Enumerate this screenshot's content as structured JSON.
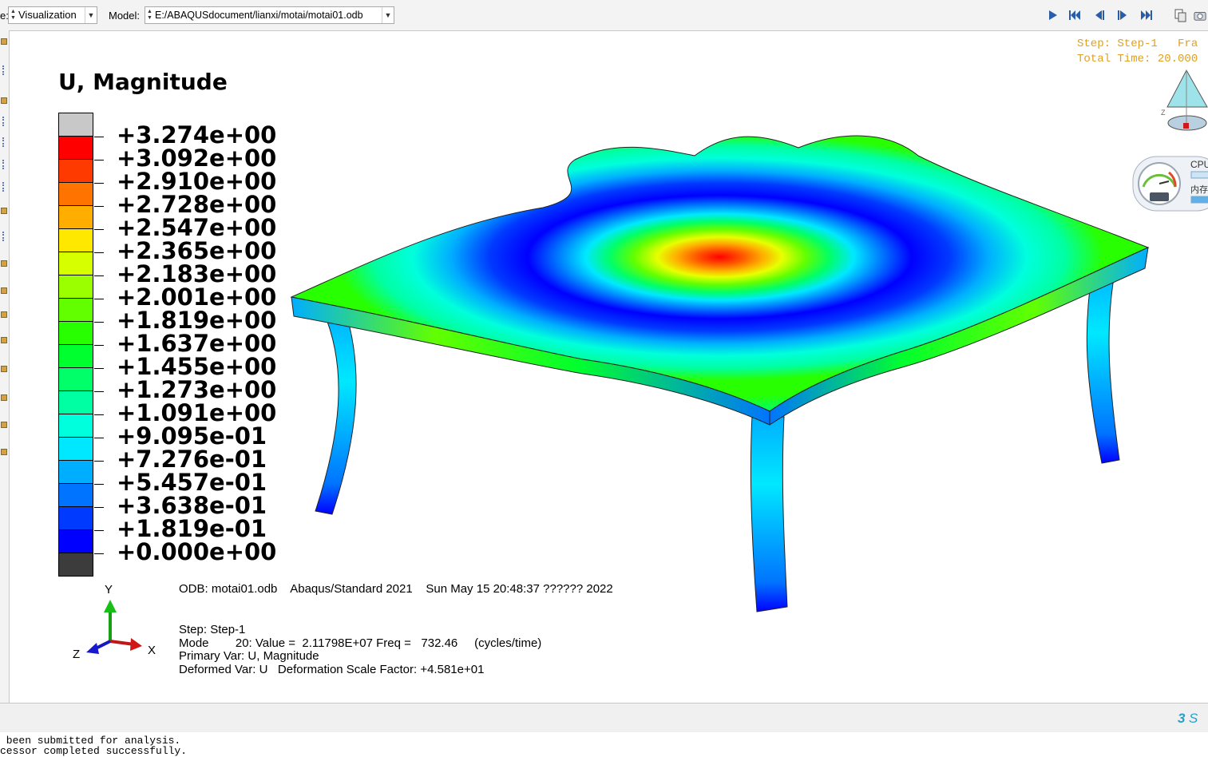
{
  "toolbar": {
    "module_label_fragment": "e:",
    "module_value": "Visualization",
    "model_label": "Model:",
    "model_value": "E:/ABAQUSdocument/lianxi/motai/motai01.odb",
    "animation_buttons": [
      "play-icon",
      "first-frame-icon",
      "previous-frame-icon",
      "next-frame-icon",
      "last-frame-icon"
    ]
  },
  "legend": {
    "title": "U, Magnitude",
    "values": [
      "+3.274e+00",
      "+3.092e+00",
      "+2.910e+00",
      "+2.728e+00",
      "+2.547e+00",
      "+2.365e+00",
      "+2.183e+00",
      "+2.001e+00",
      "+1.819e+00",
      "+1.637e+00",
      "+1.455e+00",
      "+1.273e+00",
      "+1.091e+00",
      "+9.095e-01",
      "+7.276e-01",
      "+5.457e-01",
      "+3.638e-01",
      "+1.819e-01",
      "+0.000e+00"
    ],
    "colors": [
      "#c8c8c8",
      "#ff0000",
      "#ff3a00",
      "#ff7400",
      "#ffae00",
      "#ffe800",
      "#d6ff00",
      "#9cff00",
      "#62ff00",
      "#28ff00",
      "#00ff2e",
      "#00ff68",
      "#00ffa2",
      "#00ffdc",
      "#00e8ff",
      "#00aeff",
      "#0074ff",
      "#003aff",
      "#0000ff",
      "#3c3c3c"
    ]
  },
  "info": {
    "odb_line": "ODB: motai01.odb    Abaqus/Standard 2021    Sun May 15 20:48:37 ?????? 2022",
    "step_line": "Step: Step-1",
    "mode_line": "Mode        20: Value =  2.11798E+07 Freq =   732.46     (cycles/time)",
    "primary_var_line": "Primary Var: U, Magnitude",
    "deformed_var_line": "Deformed Var: U   Deformation Scale Factor: +4.581e+01"
  },
  "triad": {
    "y": "Y",
    "x": "X",
    "z": "Z"
  },
  "step_overlay": {
    "line1": "Step: Step-1   Fra",
    "line2": "Total Time: 20.000"
  },
  "viewcube": {
    "axis_label": "Z"
  },
  "cpu_widget": {
    "cpu_label": "CPU",
    "mem_label": "内存"
  },
  "messages": [
    " been submitted for analysis.",
    "cessor completed successfully."
  ]
}
